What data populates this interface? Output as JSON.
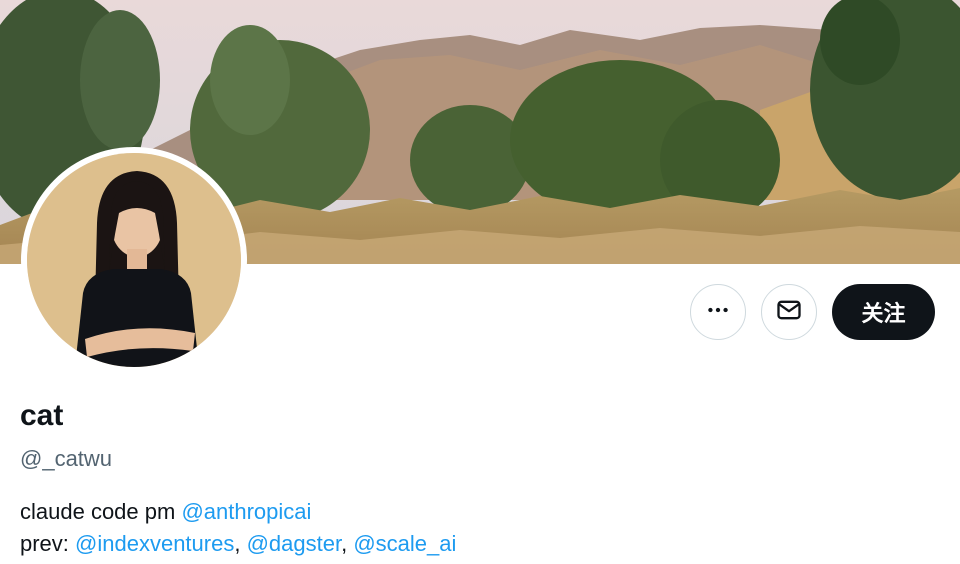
{
  "profile": {
    "display_name": "cat",
    "handle": "@_catwu",
    "bio_line1_text": "claude code pm ",
    "bio_line1_mention": "@anthropicai",
    "bio_line2_prefix": "prev: ",
    "bio_line2_mentions": [
      "@indexventures",
      "@dagster",
      "@scale_ai"
    ],
    "bio_separator": ", "
  },
  "actions": {
    "more_icon": "more-horizontal-icon",
    "message_icon": "envelope-icon",
    "follow_label": "关注"
  },
  "colors": {
    "mention": "#1d9bf0",
    "follow_bg": "#0f1419",
    "handle": "#536471",
    "border": "#cfd9de"
  }
}
